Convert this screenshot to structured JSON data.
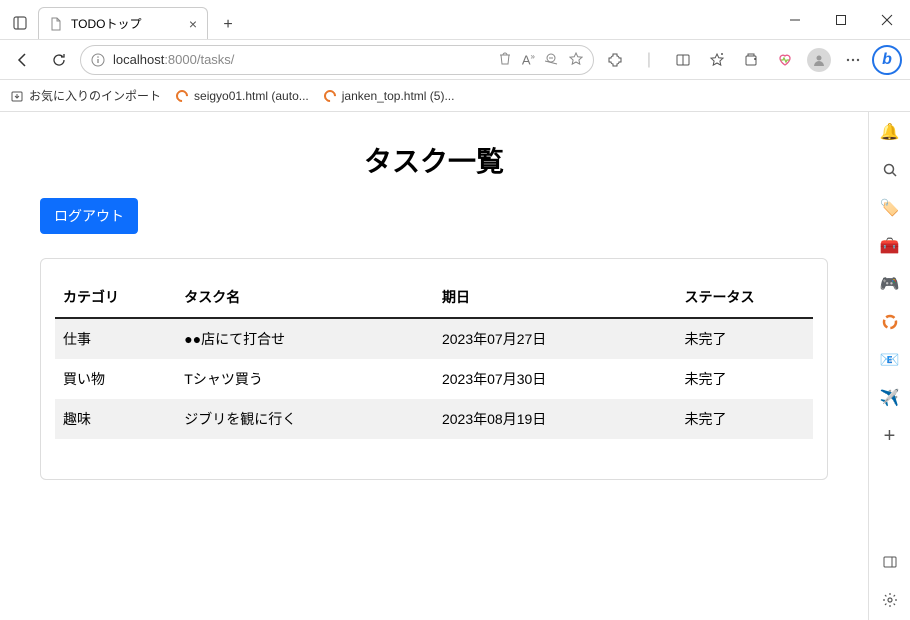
{
  "browser": {
    "tab_title": "TODOトップ",
    "url_host": "localhost",
    "url_port_path": ":8000/tasks/",
    "bookmarks_import": "お気に入りのインポート",
    "bookmark1": "seigyo01.html (auto...",
    "bookmark2": "janken_top.html (5)..."
  },
  "page": {
    "title": "タスク一覧",
    "logout_label": "ログアウト",
    "headers": {
      "category": "カテゴリ",
      "name": "タスク名",
      "date": "期日",
      "status": "ステータス"
    },
    "rows": [
      {
        "category": "仕事",
        "name": "●●店にて打合せ",
        "date": "2023年07月27日",
        "status": "未完了"
      },
      {
        "category": "買い物",
        "name": "Tシャツ買う",
        "date": "2023年07月30日",
        "status": "未完了"
      },
      {
        "category": "趣味",
        "name": "ジブリを観に行く",
        "date": "2023年08月19日",
        "status": "未完了"
      }
    ]
  }
}
